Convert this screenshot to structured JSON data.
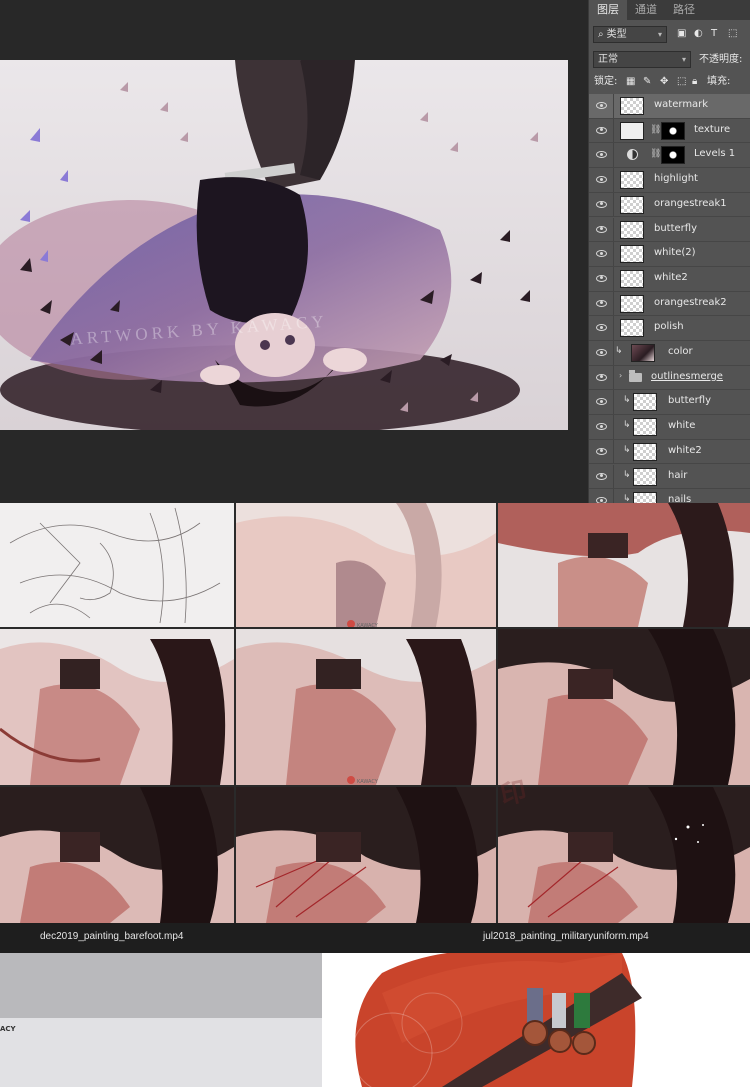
{
  "layers_panel": {
    "tabs": [
      {
        "label": "图层",
        "active": true
      },
      {
        "label": "通道",
        "active": false
      },
      {
        "label": "路径",
        "active": false
      }
    ],
    "filter_kind": "类型",
    "blend_mode": "正常",
    "opacity_label": "不透明度:",
    "lock_label": "锁定:",
    "fill_label": "填充:",
    "layers": [
      {
        "name": "watermark",
        "selected": true
      },
      {
        "name": "texture",
        "has_mask": true
      },
      {
        "name": "Levels 1",
        "adjustment": true,
        "has_mask": true
      },
      {
        "name": "highlight"
      },
      {
        "name": "orangestreak1"
      },
      {
        "name": "butterfly"
      },
      {
        "name": "white(2)"
      },
      {
        "name": "white2"
      },
      {
        "name": "orangestreak2"
      },
      {
        "name": "polish"
      },
      {
        "name": "color",
        "clipped": true
      },
      {
        "name": "outlinesmerge",
        "group": true
      },
      {
        "name": "butterfly",
        "clipped": true
      },
      {
        "name": "white",
        "clipped": true
      },
      {
        "name": "white2",
        "clipped": true
      },
      {
        "name": "hair",
        "clipped": true
      },
      {
        "name": "nails",
        "clipped": true
      }
    ]
  },
  "canvas": {
    "watermark_text": "ARTWORK BY KAWACY"
  },
  "process_grid": {
    "small_watermark": "KAWACY",
    "overlay_watermark": "印"
  },
  "captions": {
    "left": "dec2019_painting_barefoot.mp4",
    "right": "jul2018_painting_militaryuniform.mp4"
  },
  "bottom_left": {
    "partial_text": "ACY"
  },
  "colors": {
    "panel_bg": "#535353",
    "selected_layer": "#696969",
    "workspace": "#282828"
  }
}
